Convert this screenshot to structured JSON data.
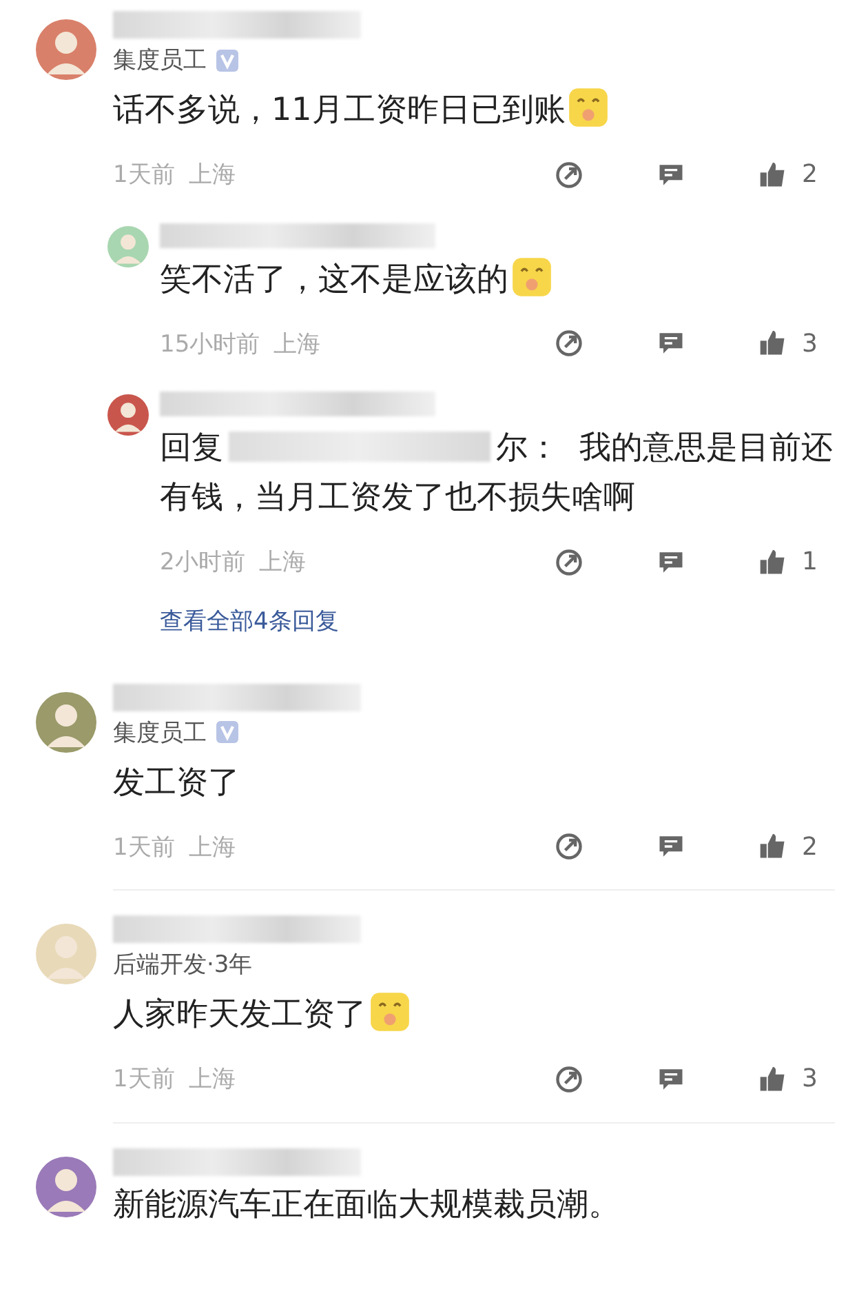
{
  "comments": [
    {
      "avatar": {
        "color": "#d9806a"
      },
      "badge": "集度员工",
      "verified": true,
      "text": "话不多说，11月工资昨日已到账",
      "emoji": true,
      "time": "1天前",
      "location": "上海",
      "likes": "2",
      "replies": [
        {
          "avatar": {
            "color": "#a8d6b0"
          },
          "text": "笑不活了，这不是应该的",
          "emoji": true,
          "time": "15小时前",
          "location": "上海",
          "likes": "3"
        },
        {
          "avatar": {
            "color": "#c9564c"
          },
          "reply_prefix": "回复",
          "reply_suffix": "尔：",
          "text": "我的意思是目前还有钱，当月工资发了也不损失啥啊",
          "emoji": false,
          "time": "2小时前",
          "location": "上海",
          "likes": "1"
        }
      ],
      "more_replies": "查看全部4条回复"
    },
    {
      "avatar": {
        "color": "#9a9a6a"
      },
      "badge": "集度员工",
      "verified": true,
      "text": "发工资了",
      "emoji": false,
      "time": "1天前",
      "location": "上海",
      "likes": "2"
    },
    {
      "avatar": {
        "color": "#e8d9b8"
      },
      "subtitle": "后端开发·3年",
      "text": "人家昨天发工资了",
      "emoji": true,
      "time": "1天前",
      "location": "上海",
      "likes": "3"
    },
    {
      "avatar": {
        "color": "#9a7ab8"
      },
      "text": "新能源汽车正在面临大规模裁员潮。",
      "emoji": false
    }
  ]
}
